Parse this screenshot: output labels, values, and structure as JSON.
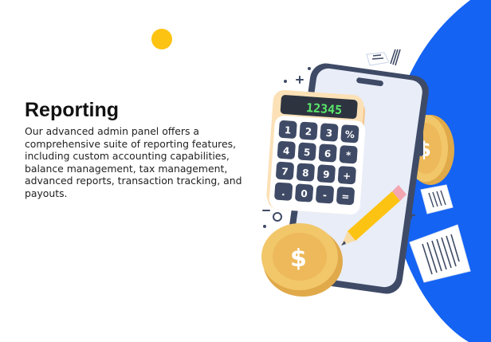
{
  "content": {
    "title": "Reporting",
    "description": "Our advanced admin panel offers a comprehensive suite of reporting features, including custom accounting capabilities, balance management, tax management, advanced reports, transaction tracking, and payouts."
  },
  "illustration": {
    "calculator_display": "12345",
    "keys": [
      [
        "1",
        "2",
        "3",
        "%"
      ],
      [
        "4",
        "5",
        "6",
        "*"
      ],
      [
        "7",
        "8",
        "9",
        "+"
      ],
      [
        ".",
        "0",
        "-",
        "="
      ]
    ],
    "coin_symbol": "$",
    "icons": [
      "phone-icon",
      "calculator-icon",
      "pencil-icon",
      "coin-icon",
      "paper-icon"
    ]
  },
  "colors": {
    "accent_blue": "#1463F3",
    "yellow_dot": "#FDC312",
    "coin_gold": "#F2C76A",
    "lcd_green": "#5BE86A",
    "calculator_body": "#FBD9A6",
    "keys_dark": "#3F4B66"
  }
}
